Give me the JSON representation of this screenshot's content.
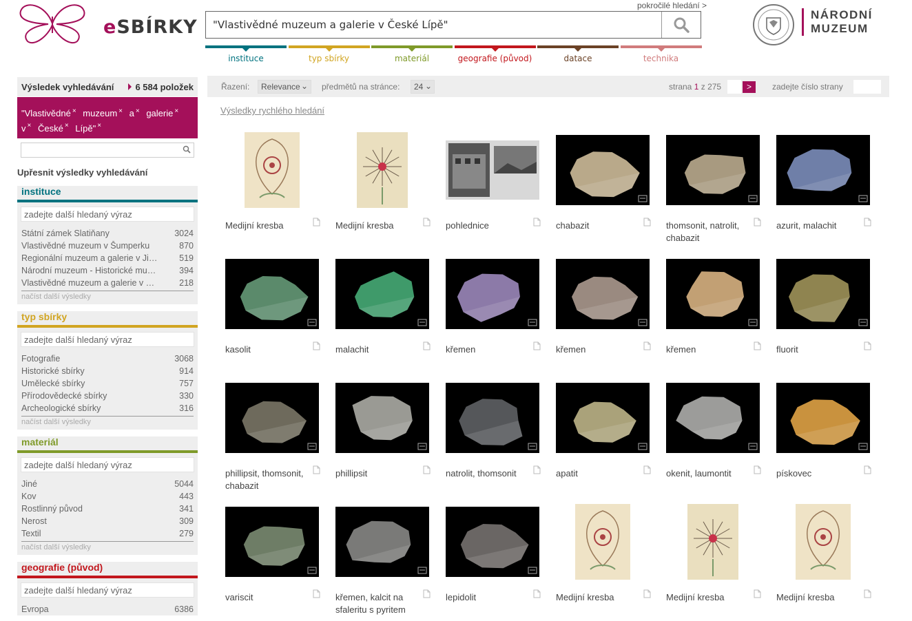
{
  "header": {
    "logo_text_e": "e",
    "logo_text_rest": "SBÍRKY",
    "search_value": "\"Vlastivědné muzeum a galerie v České Lípě\"",
    "advanced_link": "pokročilé hledání >",
    "partner_logo_line1": "NÁRODNÍ",
    "partner_logo_line2": "MUZEUM",
    "category_tabs": [
      {
        "label": "instituce",
        "color": "#00727f"
      },
      {
        "label": "typ sbírky",
        "color": "#d1a522"
      },
      {
        "label": "materiál",
        "color": "#7f9a29"
      },
      {
        "label": "geografie (původ)",
        "color": "#c2171d"
      },
      {
        "label": "datace",
        "color": "#6b4226"
      },
      {
        "label": "technika",
        "color": "#d07b7c"
      }
    ]
  },
  "sidebar": {
    "results_label": "Výsledek vyhledávání",
    "results_count": "6 584 položek",
    "query_words": [
      "\"Vlastivědné",
      "muzeum",
      "a",
      "galerie",
      "v",
      "České",
      "Lípě\""
    ],
    "refine_label": "Upřesnit výsledky vyhledávání",
    "facets": [
      {
        "title": "instituce",
        "color": "#00727f",
        "placeholder": "zadejte další hledaný výraz",
        "rows": [
          {
            "name": "Státní zámek Slatiňany",
            "count": "3024"
          },
          {
            "name": "Vlastivědné muzeum v Šumperku",
            "count": "870"
          },
          {
            "name": "Regionální muzeum a galerie v Jičíně",
            "count": "519"
          },
          {
            "name": "Národní muzeum - Historické muzeum",
            "count": "394"
          },
          {
            "name": "Vlastivědné muzeum a galerie v České Lípě",
            "count": "218"
          }
        ],
        "more": "načíst další výsledky"
      },
      {
        "title": "typ sbírky",
        "color": "#d1a522",
        "placeholder": "zadejte další hledaný výraz",
        "rows": [
          {
            "name": "Fotografie",
            "count": "3068"
          },
          {
            "name": "Historické sbírky",
            "count": "914"
          },
          {
            "name": "Umělecké sbírky",
            "count": "757"
          },
          {
            "name": "Přírodovědecké sbírky",
            "count": "330"
          },
          {
            "name": "Archeologické sbírky",
            "count": "316"
          }
        ],
        "more": "načíst další výsledky"
      },
      {
        "title": "materiál",
        "color": "#7f9a29",
        "placeholder": "zadejte další hledaný výraz",
        "rows": [
          {
            "name": "Jiné",
            "count": "5044"
          },
          {
            "name": "Kov",
            "count": "443"
          },
          {
            "name": "Rostlinný původ",
            "count": "341"
          },
          {
            "name": "Nerost",
            "count": "309"
          },
          {
            "name": "Textil",
            "count": "279"
          }
        ],
        "more": "načíst další výsledky"
      },
      {
        "title": "geografie (původ)",
        "color": "#c2171d",
        "placeholder": "zadejte další hledaný výraz",
        "rows": [
          {
            "name": "Evropa",
            "count": "6386"
          }
        ],
        "more": ""
      }
    ]
  },
  "toolbar": {
    "sort_label": "Řazení:",
    "sort_value": "Relevance",
    "per_page_label": "předmětů na stránce:",
    "per_page_value": "24",
    "page_prefix": "strana",
    "page_current": "1",
    "page_sep": "z",
    "page_total": "275",
    "next_label": ">",
    "goto_label": "zadejte číslo strany"
  },
  "quick_results_link": "Výsledky rychlého hledání",
  "items": [
    {
      "title": "Medijní kresba",
      "kind": "drawing"
    },
    {
      "title": "Medijní kresba",
      "kind": "drawing2"
    },
    {
      "title": "pohlednice",
      "kind": "postcard"
    },
    {
      "title": "chabazit",
      "kind": "mineral",
      "color": "#b9a98a"
    },
    {
      "title": "thomsonit, natrolit, chabazit",
      "kind": "mineral",
      "color": "#a89a80"
    },
    {
      "title": "azurit, malachit",
      "kind": "mineral",
      "color": "#6f7fa8"
    },
    {
      "title": "kasolit",
      "kind": "mineral",
      "color": "#5b8a6b"
    },
    {
      "title": "malachit",
      "kind": "mineral",
      "color": "#3f9a6a"
    },
    {
      "title": "křemen",
      "kind": "mineral",
      "color": "#8c7aa8"
    },
    {
      "title": "křemen",
      "kind": "mineral",
      "color": "#9a8a80"
    },
    {
      "title": "křemen",
      "kind": "mineral",
      "color": "#c2a074"
    },
    {
      "title": "fluorit",
      "kind": "mineral",
      "color": "#8f8450"
    },
    {
      "title": "phillipsit, thomsonit, chabazit",
      "kind": "mineral",
      "color": "#6e6a5c"
    },
    {
      "title": "phillipsit",
      "kind": "mineral",
      "color": "#9a9a94"
    },
    {
      "title": "natrolit, thomsonit",
      "kind": "mineral",
      "color": "#55575a"
    },
    {
      "title": "apatit",
      "kind": "mineral",
      "color": "#aaa27a"
    },
    {
      "title": "okenit, laumontit",
      "kind": "mineral",
      "color": "#9c9c9a"
    },
    {
      "title": "pískovec",
      "kind": "mineral",
      "color": "#c9923e"
    },
    {
      "title": "variscit",
      "kind": "mineral",
      "color": "#6e7d66"
    },
    {
      "title": "křemen, kalcit na sfaleritu s pyritem",
      "kind": "mineral",
      "color": "#7a7a78"
    },
    {
      "title": "lepidolit",
      "kind": "mineral",
      "color": "#6a6664"
    },
    {
      "title": "Medijní kresba",
      "kind": "drawing"
    },
    {
      "title": "Medijní kresba",
      "kind": "drawing2"
    },
    {
      "title": "Medijní kresba",
      "kind": "drawing"
    }
  ]
}
